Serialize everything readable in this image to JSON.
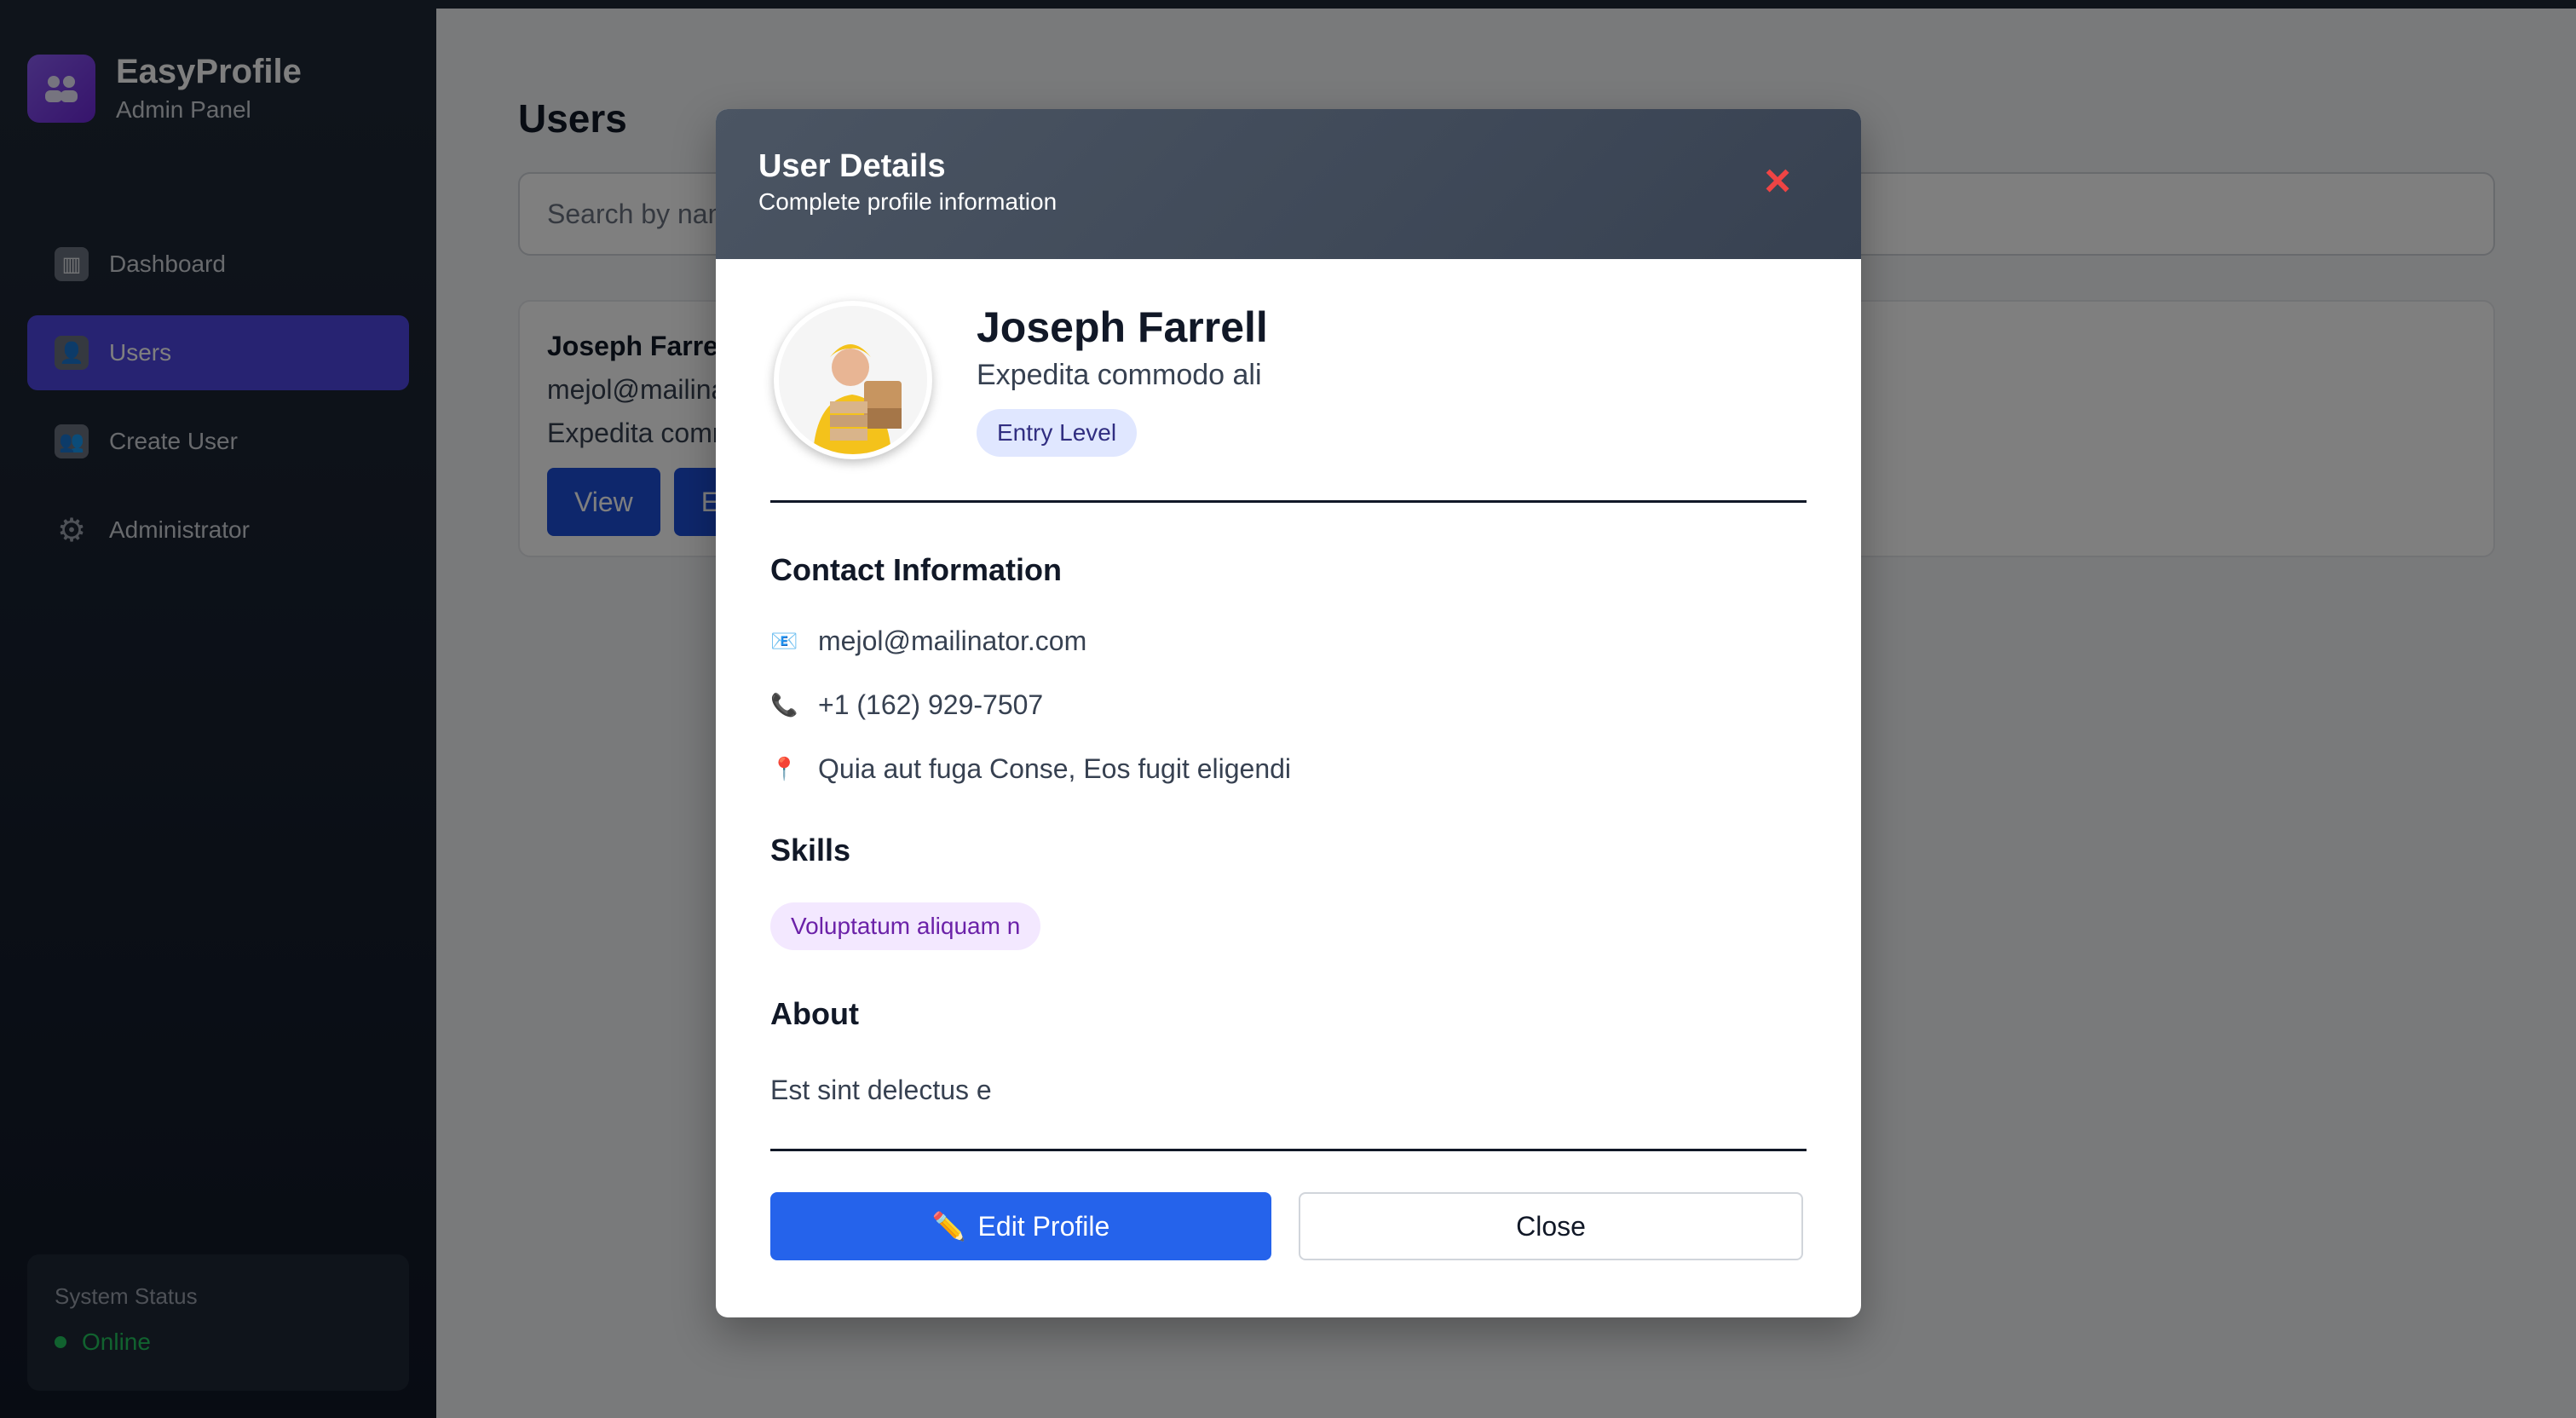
{
  "brand": {
    "title": "EasyProfile",
    "subtitle": "Admin Panel"
  },
  "nav": [
    {
      "label": "Dashboard",
      "icon": "dashboard-icon",
      "active": false
    },
    {
      "label": "Users",
      "icon": "users-icon",
      "active": true
    },
    {
      "label": "Create User",
      "icon": "create-user-icon",
      "active": false
    },
    {
      "label": "Administrator",
      "icon": "gear-icon",
      "active": false
    }
  ],
  "status": {
    "label": "System Status",
    "value": "Online",
    "color": "#22c55e"
  },
  "page": {
    "title": "Users",
    "search_placeholder": "Search by name"
  },
  "user_card": {
    "name": "Joseph Farrell",
    "email": "mejol@mailinator.com",
    "role": "Expedita commodo ali",
    "view_label": "View",
    "edit_label": "Edit"
  },
  "modal": {
    "title": "User Details",
    "subtitle": "Complete profile information",
    "close_icon": "×",
    "name": "Joseph Farrell",
    "role": "Expedita commodo ali",
    "level": "Entry Level",
    "contact_title": "Contact Information",
    "email": "mejol@mailinator.com",
    "phone": "+1 (162) 929-7507",
    "address": "Quia aut fuga Conse, Eos fugit eligendi",
    "skills_title": "Skills",
    "skills": [
      "Voluptatum aliquam n"
    ],
    "about_title": "About",
    "about": "Est sint delectus e",
    "edit_label": "Edit Profile",
    "close_label": "Close"
  }
}
